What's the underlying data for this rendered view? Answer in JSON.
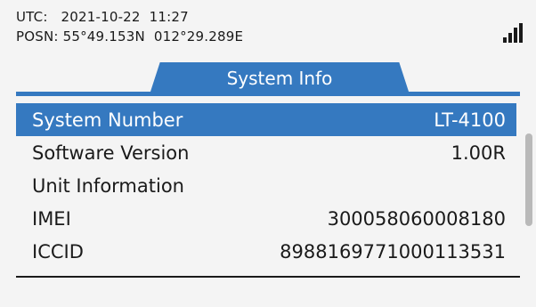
{
  "status": {
    "utc_line": "UTC:   2021-10-22  11:27",
    "posn_line": "POSN: 55°49.153N  012°29.289E"
  },
  "signal": {
    "icon": "signal-strength-icon",
    "bars": 4
  },
  "tab": {
    "title": "System Info"
  },
  "rows": [
    {
      "label": "System Number",
      "value": "LT-4100",
      "selected": true
    },
    {
      "label": "Software Version",
      "value": "1.00R",
      "selected": false
    },
    {
      "label": "Unit Information",
      "value": "",
      "selected": false
    },
    {
      "label": "IMEI",
      "value": "300058060008180",
      "selected": false
    },
    {
      "label": "ICCID",
      "value": "8988169771000113531",
      "selected": false
    }
  ],
  "colors": {
    "accent": "#3579c0",
    "background": "#f4f4f4",
    "text": "#1a1a1a"
  }
}
